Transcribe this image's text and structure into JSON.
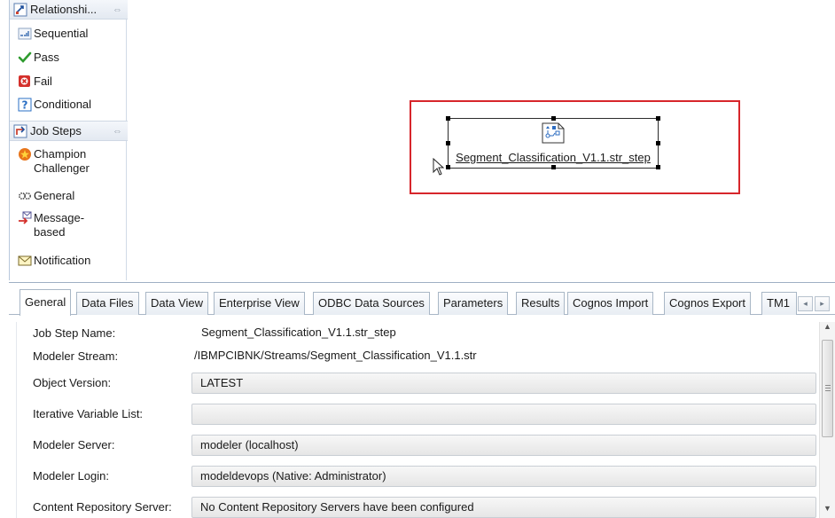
{
  "palette": {
    "relationships": {
      "title": "Relationshi...",
      "collapse_glyph": "⇔",
      "items": [
        {
          "label": "Sequential",
          "icon": "sequential-icon"
        },
        {
          "label": "Pass",
          "icon": "checkmark-icon"
        },
        {
          "label": "Fail",
          "icon": "fail-icon"
        },
        {
          "label": "Conditional",
          "icon": "question-icon"
        }
      ]
    },
    "job_steps": {
      "title": "Job Steps",
      "collapse_glyph": "⇔",
      "items": [
        {
          "label_line1": "Champion",
          "label_line2": "Challenger",
          "icon": "star-badge-icon"
        },
        {
          "label": "General",
          "icon": "gears-icon"
        },
        {
          "label_line1": "Message-",
          "label_line2": "based",
          "icon": "message-arrow-icon"
        },
        {
          "label": "Notification",
          "icon": "envelope-icon"
        }
      ]
    }
  },
  "canvas": {
    "node": {
      "label": "Segment_Classification_V1.1.str_step",
      "icon": "stream-step-icon",
      "selected": true
    },
    "highlight_color": "#d7262b"
  },
  "properties": {
    "tabs": [
      {
        "label": "General",
        "active": true
      },
      {
        "label": "Data Files"
      },
      {
        "label": "Data View"
      },
      {
        "label": "Enterprise View"
      },
      {
        "label": "ODBC Data Sources"
      },
      {
        "label": "Parameters"
      },
      {
        "label": "Results"
      },
      {
        "label": "Cognos Import"
      },
      {
        "label": "Cognos Export"
      },
      {
        "label": "TM1"
      }
    ],
    "tab_scroll": {
      "left": "◂",
      "right": "▸"
    },
    "fields": [
      {
        "label": "Job Step Name:",
        "value": "Segment_Classification_V1.1.str_step",
        "style": "text"
      },
      {
        "label": "Modeler Stream:",
        "value": "/IBMPCIBNK/Streams/Segment_Classification_V1.1.str",
        "style": "readonly"
      },
      {
        "label": "Object Version:",
        "value": "LATEST",
        "style": "combo"
      },
      {
        "label": "Iterative Variable List:",
        "value": "",
        "style": "combo"
      },
      {
        "label": "Modeler Server:",
        "value": "modeler (localhost)",
        "style": "combo"
      },
      {
        "label": "Modeler Login:",
        "value": "modeldevops (Native: Administrator)",
        "style": "combo"
      },
      {
        "label": "Content Repository Server:",
        "value": "No Content Repository Servers have been configured",
        "style": "combo"
      }
    ]
  }
}
